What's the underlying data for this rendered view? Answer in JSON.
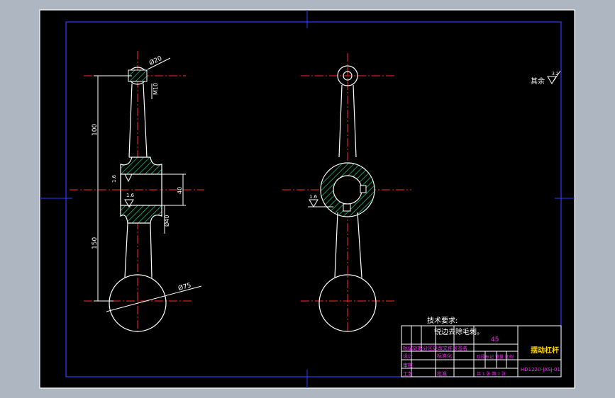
{
  "drawing": {
    "background": "#000000",
    "outer_border_color": "#ffffff",
    "inner_border_color": "#2f3cff",
    "centerline_color": "#ff2a2a",
    "part_outline_color": "#ffffff",
    "dimension_color": "#ffffff",
    "hatch_color": "#19d08a",
    "title_text_color": "#ff2bff",
    "title_highlight_color": "#ffd400"
  },
  "dimensions": {
    "dia_20": "Ø20",
    "m10": "M10",
    "len_100": "100",
    "len_150": "150",
    "len_40": "40",
    "dia_40": "Ø40",
    "dia_75": "Ø75",
    "rough_1": "1.6",
    "rough_2": "1.6",
    "rough_3": "1.6"
  },
  "notes": {
    "roughness_other": "其余",
    "roughness_other_value": "3.2",
    "tech_title": "技术要求:",
    "tech_item": "锐边去除毛刺。"
  },
  "title_block": {
    "material": "45",
    "part_name": "摆动杠杆",
    "drawing_no": "HD1220-JXSJ-01",
    "std_note": "标记处数分区更改文件号签名",
    "design_label": "设计",
    "standardize_label": "标准化",
    "scale_labels": "阶段标记 重量 比例",
    "review_label": "审核",
    "process_label": "工艺",
    "approve_label": "批准",
    "sheet_label": "共 1 张 第 1 张"
  }
}
